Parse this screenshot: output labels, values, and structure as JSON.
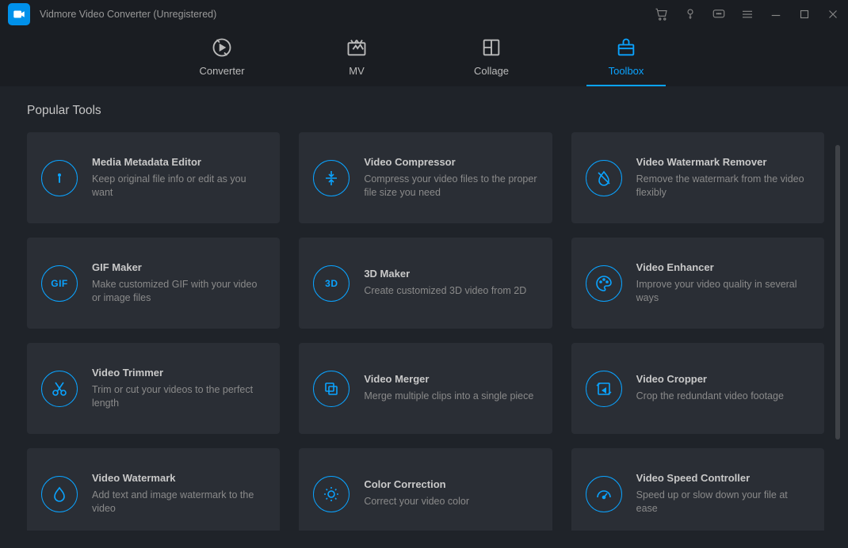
{
  "app_title": "Vidmore Video Converter (Unregistered)",
  "tabs": [
    {
      "label": "Converter"
    },
    {
      "label": "MV"
    },
    {
      "label": "Collage"
    },
    {
      "label": "Toolbox"
    }
  ],
  "section_title": "Popular Tools",
  "tools": [
    {
      "title": "Media Metadata Editor",
      "desc": "Keep original file info or edit as you want",
      "icon": "info"
    },
    {
      "title": "Video Compressor",
      "desc": "Compress your video files to the proper file size you need",
      "icon": "compress"
    },
    {
      "title": "Video Watermark Remover",
      "desc": "Remove the watermark from the video flexibly",
      "icon": "drop-slash"
    },
    {
      "title": "GIF Maker",
      "desc": "Make customized GIF with your video or image files",
      "icon": "gif"
    },
    {
      "title": "3D Maker",
      "desc": "Create customized 3D video from 2D",
      "icon": "3d"
    },
    {
      "title": "Video Enhancer",
      "desc": "Improve your video quality in several ways",
      "icon": "palette"
    },
    {
      "title": "Video Trimmer",
      "desc": "Trim or cut your videos to the perfect length",
      "icon": "scissors"
    },
    {
      "title": "Video Merger",
      "desc": "Merge multiple clips into a single piece",
      "icon": "merge"
    },
    {
      "title": "Video Cropper",
      "desc": "Crop the redundant video footage",
      "icon": "crop"
    },
    {
      "title": "Video Watermark",
      "desc": "Add text and image watermark to the video",
      "icon": "drop"
    },
    {
      "title": "Color Correction",
      "desc": "Correct your video color",
      "icon": "sun"
    },
    {
      "title": "Video Speed Controller",
      "desc": "Speed up or slow down your file at ease",
      "icon": "gauge"
    }
  ]
}
